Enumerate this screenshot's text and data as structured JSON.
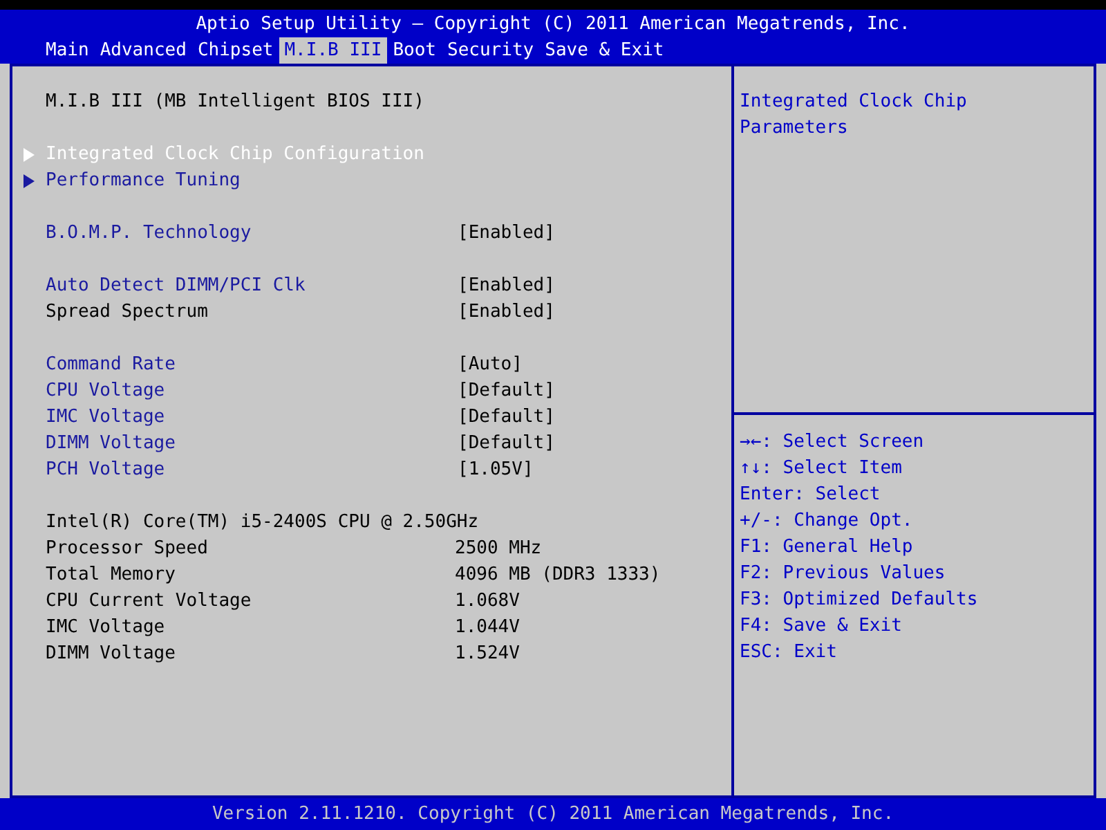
{
  "title": "Aptio Setup Utility – Copyright (C) 2011 American Megatrends, Inc.",
  "tabs": [
    {
      "label": "Main",
      "selected": false
    },
    {
      "label": "Advanced",
      "selected": false
    },
    {
      "label": "Chipset",
      "selected": false
    },
    {
      "label": "M.I.B III",
      "selected": true
    },
    {
      "label": "Boot",
      "selected": false
    },
    {
      "label": "Security",
      "selected": false
    },
    {
      "label": "Save & Exit",
      "selected": false
    }
  ],
  "groups": [
    [
      {
        "kind": "heading",
        "label": "M.I.B III (MB Intelligent BIOS III)"
      }
    ],
    [
      {
        "kind": "submenu",
        "label": "Integrated Clock Chip Configuration",
        "selected": true
      },
      {
        "kind": "submenu",
        "label": "Performance Tuning",
        "selected": false
      }
    ],
    [
      {
        "kind": "setting",
        "label": "B.O.M.P. Technology",
        "value": "[Enabled]",
        "editable": true
      }
    ],
    [
      {
        "kind": "setting",
        "label": "Auto Detect DIMM/PCI Clk",
        "value": "[Enabled]",
        "editable": true
      },
      {
        "kind": "setting",
        "label": "Spread Spectrum",
        "value": "[Enabled]",
        "editable": false
      }
    ],
    [
      {
        "kind": "setting",
        "label": "Command Rate",
        "value": "[Auto]",
        "editable": true
      },
      {
        "kind": "setting",
        "label": "CPU Voltage",
        "value": "[Default]",
        "editable": true
      },
      {
        "kind": "setting",
        "label": "IMC Voltage",
        "value": "[Default]",
        "editable": true
      },
      {
        "kind": "setting",
        "label": "DIMM Voltage",
        "value": "[Default]",
        "editable": true
      },
      {
        "kind": "setting",
        "label": "PCH Voltage",
        "value": "[1.05V]",
        "editable": true
      }
    ],
    [
      {
        "kind": "heading",
        "label": "Intel(R) Core(TM) i5-2400S CPU @ 2.50GHz"
      },
      {
        "kind": "info",
        "label": "Processor Speed",
        "value": "2500 MHz"
      },
      {
        "kind": "info",
        "label": "Total Memory",
        "value": "4096 MB (DDR3 1333)"
      },
      {
        "kind": "info",
        "label": "CPU Current Voltage",
        "value": "1.068V"
      },
      {
        "kind": "info",
        "label": "IMC Voltage",
        "value": "1.044V"
      },
      {
        "kind": "info",
        "label": "DIMM Voltage",
        "value": "1.524V"
      }
    ]
  ],
  "help": "Integrated Clock Chip Parameters",
  "keys": [
    "→←: Select Screen",
    "↑↓: Select Item",
    "Enter: Select",
    "+/-: Change Opt.",
    "F1: General Help",
    "F2: Previous Values",
    "F3: Optimized Defaults",
    "F4: Save & Exit",
    "ESC: Exit"
  ],
  "footer": "Version 2.11.1210. Copyright (C) 2011 American Megatrends, Inc."
}
